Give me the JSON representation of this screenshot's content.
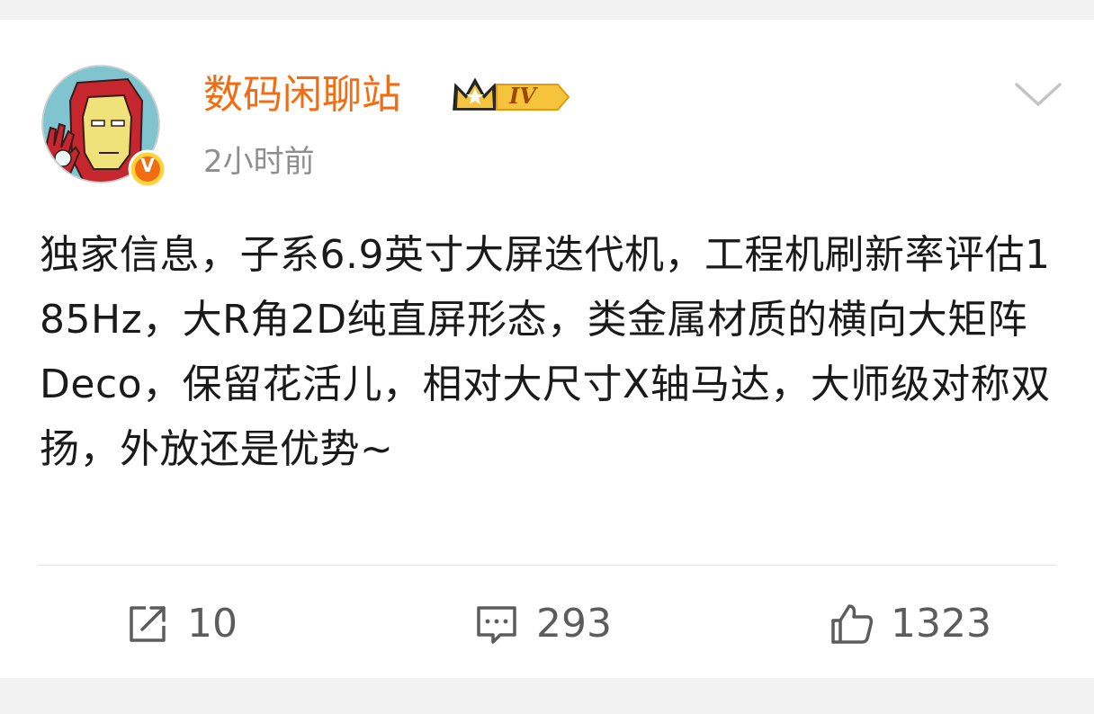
{
  "post": {
    "author": {
      "name": "数码闲聊站",
      "level_badge": "IV",
      "verified_mark": "V"
    },
    "timestamp": "2小时前",
    "text": "独家信息，子系6.9英寸大屏迭代机，工程机刷新率评估185Hz，大R角2D纯直屏形态，类金属材质的横向大矩阵Deco，保留花活儿，相对大尺寸X轴马达，大师级对称双扬，外放还是优势~"
  },
  "actions": {
    "repost": {
      "count": "10",
      "icon": "share-icon"
    },
    "comment": {
      "count": "293",
      "icon": "comment-icon"
    },
    "like": {
      "count": "1323",
      "icon": "thumbs-up-icon"
    }
  },
  "colors": {
    "username": "#f26d12",
    "timestamp": "#8e8e8e",
    "body_text": "#1a1a1a",
    "action_text": "#5c5c5c",
    "background": "#f2f2f2",
    "card": "#ffffff"
  }
}
